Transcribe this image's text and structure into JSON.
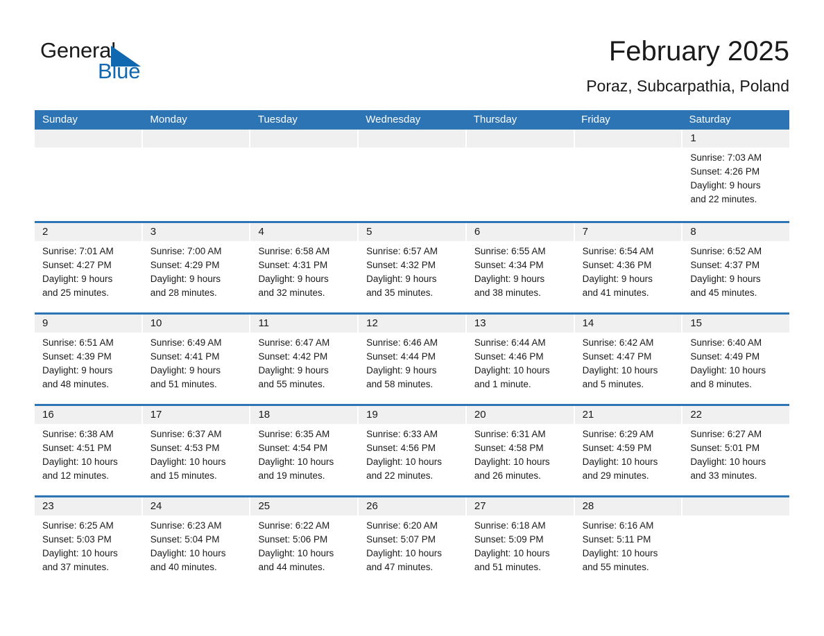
{
  "brand": {
    "line1": "General",
    "line2": "Blue",
    "triangle_color": "#1068b0"
  },
  "header": {
    "title": "February 2025",
    "subtitle": "Poraz, Subcarpathia, Poland"
  },
  "theme": {
    "header_blue": "#2d74b5",
    "daynum_band": "#f0f0f0",
    "text": "#1a1a1a"
  },
  "weekdays": [
    "Sunday",
    "Monday",
    "Tuesday",
    "Wednesday",
    "Thursday",
    "Friday",
    "Saturday"
  ],
  "weeks": [
    [
      {
        "day": "",
        "empty": true
      },
      {
        "day": "",
        "empty": true
      },
      {
        "day": "",
        "empty": true
      },
      {
        "day": "",
        "empty": true
      },
      {
        "day": "",
        "empty": true
      },
      {
        "day": "",
        "empty": true
      },
      {
        "day": "1",
        "sunrise": "Sunrise: 7:03 AM",
        "sunset": "Sunset: 4:26 PM",
        "daylight1": "Daylight: 9 hours",
        "daylight2": "and 22 minutes."
      }
    ],
    [
      {
        "day": "2",
        "sunrise": "Sunrise: 7:01 AM",
        "sunset": "Sunset: 4:27 PM",
        "daylight1": "Daylight: 9 hours",
        "daylight2": "and 25 minutes."
      },
      {
        "day": "3",
        "sunrise": "Sunrise: 7:00 AM",
        "sunset": "Sunset: 4:29 PM",
        "daylight1": "Daylight: 9 hours",
        "daylight2": "and 28 minutes."
      },
      {
        "day": "4",
        "sunrise": "Sunrise: 6:58 AM",
        "sunset": "Sunset: 4:31 PM",
        "daylight1": "Daylight: 9 hours",
        "daylight2": "and 32 minutes."
      },
      {
        "day": "5",
        "sunrise": "Sunrise: 6:57 AM",
        "sunset": "Sunset: 4:32 PM",
        "daylight1": "Daylight: 9 hours",
        "daylight2": "and 35 minutes."
      },
      {
        "day": "6",
        "sunrise": "Sunrise: 6:55 AM",
        "sunset": "Sunset: 4:34 PM",
        "daylight1": "Daylight: 9 hours",
        "daylight2": "and 38 minutes."
      },
      {
        "day": "7",
        "sunrise": "Sunrise: 6:54 AM",
        "sunset": "Sunset: 4:36 PM",
        "daylight1": "Daylight: 9 hours",
        "daylight2": "and 41 minutes."
      },
      {
        "day": "8",
        "sunrise": "Sunrise: 6:52 AM",
        "sunset": "Sunset: 4:37 PM",
        "daylight1": "Daylight: 9 hours",
        "daylight2": "and 45 minutes."
      }
    ],
    [
      {
        "day": "9",
        "sunrise": "Sunrise: 6:51 AM",
        "sunset": "Sunset: 4:39 PM",
        "daylight1": "Daylight: 9 hours",
        "daylight2": "and 48 minutes."
      },
      {
        "day": "10",
        "sunrise": "Sunrise: 6:49 AM",
        "sunset": "Sunset: 4:41 PM",
        "daylight1": "Daylight: 9 hours",
        "daylight2": "and 51 minutes."
      },
      {
        "day": "11",
        "sunrise": "Sunrise: 6:47 AM",
        "sunset": "Sunset: 4:42 PM",
        "daylight1": "Daylight: 9 hours",
        "daylight2": "and 55 minutes."
      },
      {
        "day": "12",
        "sunrise": "Sunrise: 6:46 AM",
        "sunset": "Sunset: 4:44 PM",
        "daylight1": "Daylight: 9 hours",
        "daylight2": "and 58 minutes."
      },
      {
        "day": "13",
        "sunrise": "Sunrise: 6:44 AM",
        "sunset": "Sunset: 4:46 PM",
        "daylight1": "Daylight: 10 hours",
        "daylight2": "and 1 minute."
      },
      {
        "day": "14",
        "sunrise": "Sunrise: 6:42 AM",
        "sunset": "Sunset: 4:47 PM",
        "daylight1": "Daylight: 10 hours",
        "daylight2": "and 5 minutes."
      },
      {
        "day": "15",
        "sunrise": "Sunrise: 6:40 AM",
        "sunset": "Sunset: 4:49 PM",
        "daylight1": "Daylight: 10 hours",
        "daylight2": "and 8 minutes."
      }
    ],
    [
      {
        "day": "16",
        "sunrise": "Sunrise: 6:38 AM",
        "sunset": "Sunset: 4:51 PM",
        "daylight1": "Daylight: 10 hours",
        "daylight2": "and 12 minutes."
      },
      {
        "day": "17",
        "sunrise": "Sunrise: 6:37 AM",
        "sunset": "Sunset: 4:53 PM",
        "daylight1": "Daylight: 10 hours",
        "daylight2": "and 15 minutes."
      },
      {
        "day": "18",
        "sunrise": "Sunrise: 6:35 AM",
        "sunset": "Sunset: 4:54 PM",
        "daylight1": "Daylight: 10 hours",
        "daylight2": "and 19 minutes."
      },
      {
        "day": "19",
        "sunrise": "Sunrise: 6:33 AM",
        "sunset": "Sunset: 4:56 PM",
        "daylight1": "Daylight: 10 hours",
        "daylight2": "and 22 minutes."
      },
      {
        "day": "20",
        "sunrise": "Sunrise: 6:31 AM",
        "sunset": "Sunset: 4:58 PM",
        "daylight1": "Daylight: 10 hours",
        "daylight2": "and 26 minutes."
      },
      {
        "day": "21",
        "sunrise": "Sunrise: 6:29 AM",
        "sunset": "Sunset: 4:59 PM",
        "daylight1": "Daylight: 10 hours",
        "daylight2": "and 29 minutes."
      },
      {
        "day": "22",
        "sunrise": "Sunrise: 6:27 AM",
        "sunset": "Sunset: 5:01 PM",
        "daylight1": "Daylight: 10 hours",
        "daylight2": "and 33 minutes."
      }
    ],
    [
      {
        "day": "23",
        "sunrise": "Sunrise: 6:25 AM",
        "sunset": "Sunset: 5:03 PM",
        "daylight1": "Daylight: 10 hours",
        "daylight2": "and 37 minutes."
      },
      {
        "day": "24",
        "sunrise": "Sunrise: 6:23 AM",
        "sunset": "Sunset: 5:04 PM",
        "daylight1": "Daylight: 10 hours",
        "daylight2": "and 40 minutes."
      },
      {
        "day": "25",
        "sunrise": "Sunrise: 6:22 AM",
        "sunset": "Sunset: 5:06 PM",
        "daylight1": "Daylight: 10 hours",
        "daylight2": "and 44 minutes."
      },
      {
        "day": "26",
        "sunrise": "Sunrise: 6:20 AM",
        "sunset": "Sunset: 5:07 PM",
        "daylight1": "Daylight: 10 hours",
        "daylight2": "and 47 minutes."
      },
      {
        "day": "27",
        "sunrise": "Sunrise: 6:18 AM",
        "sunset": "Sunset: 5:09 PM",
        "daylight1": "Daylight: 10 hours",
        "daylight2": "and 51 minutes."
      },
      {
        "day": "28",
        "sunrise": "Sunrise: 6:16 AM",
        "sunset": "Sunset: 5:11 PM",
        "daylight1": "Daylight: 10 hours",
        "daylight2": "and 55 minutes."
      },
      {
        "day": "",
        "empty": true
      }
    ]
  ]
}
